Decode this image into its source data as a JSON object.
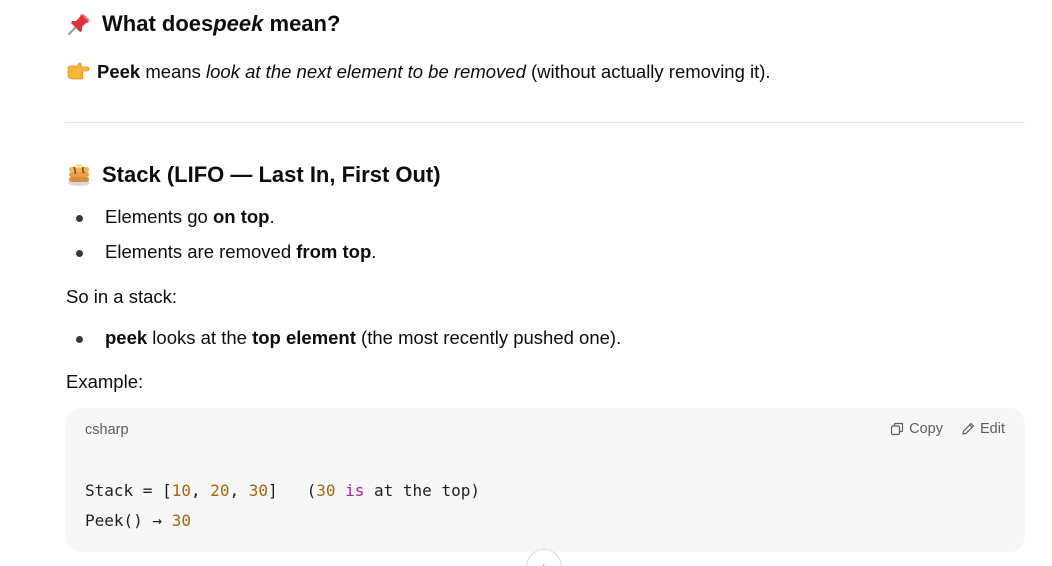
{
  "section1": {
    "heading_prefix": "What does ",
    "heading_em": "peek",
    "heading_suffix": " mean?",
    "icon": "pushpin-icon",
    "definition": {
      "icon": "pointing-hand-icon",
      "bold": "Peek",
      "middle": " means ",
      "em": "look at the next element to be removed",
      "suffix": " (without actually removing it)."
    }
  },
  "section2": {
    "heading": "Stack (LIFO — Last In, First Out)",
    "icon": "pancakes-icon",
    "bullets": [
      {
        "pre": "Elements go ",
        "bold": "on top",
        "post": "."
      },
      {
        "pre": "Elements are removed ",
        "bold": "from top",
        "post": "."
      }
    ],
    "intro": "So in a stack:",
    "peek_bullet": {
      "bold1": "peek",
      "mid": " looks at the ",
      "bold2": "top element",
      "post": " (the most recently pushed one)."
    },
    "example_label": "Example:"
  },
  "code": {
    "language": "csharp",
    "copy_label": "Copy",
    "edit_label": "Edit",
    "line1": {
      "a": "Stack = [",
      "n1": "10",
      "sep1": ", ",
      "n2": "20",
      "sep2": ", ",
      "n3": "30",
      "b": "]   (",
      "n4": "30",
      "c": " ",
      "kw": "is",
      "d": " at the top)"
    },
    "line2": {
      "a": "Peek() → ",
      "n": "30"
    }
  },
  "scroll_button": {
    "icon": "arrow-down-icon",
    "glyph": "↓"
  },
  "colors": {
    "text": "#0d0d0d",
    "code_bg": "#f7f7f8",
    "number": "#a9630b",
    "keyword": "#a626a4",
    "divider": "#e3e3e3"
  }
}
